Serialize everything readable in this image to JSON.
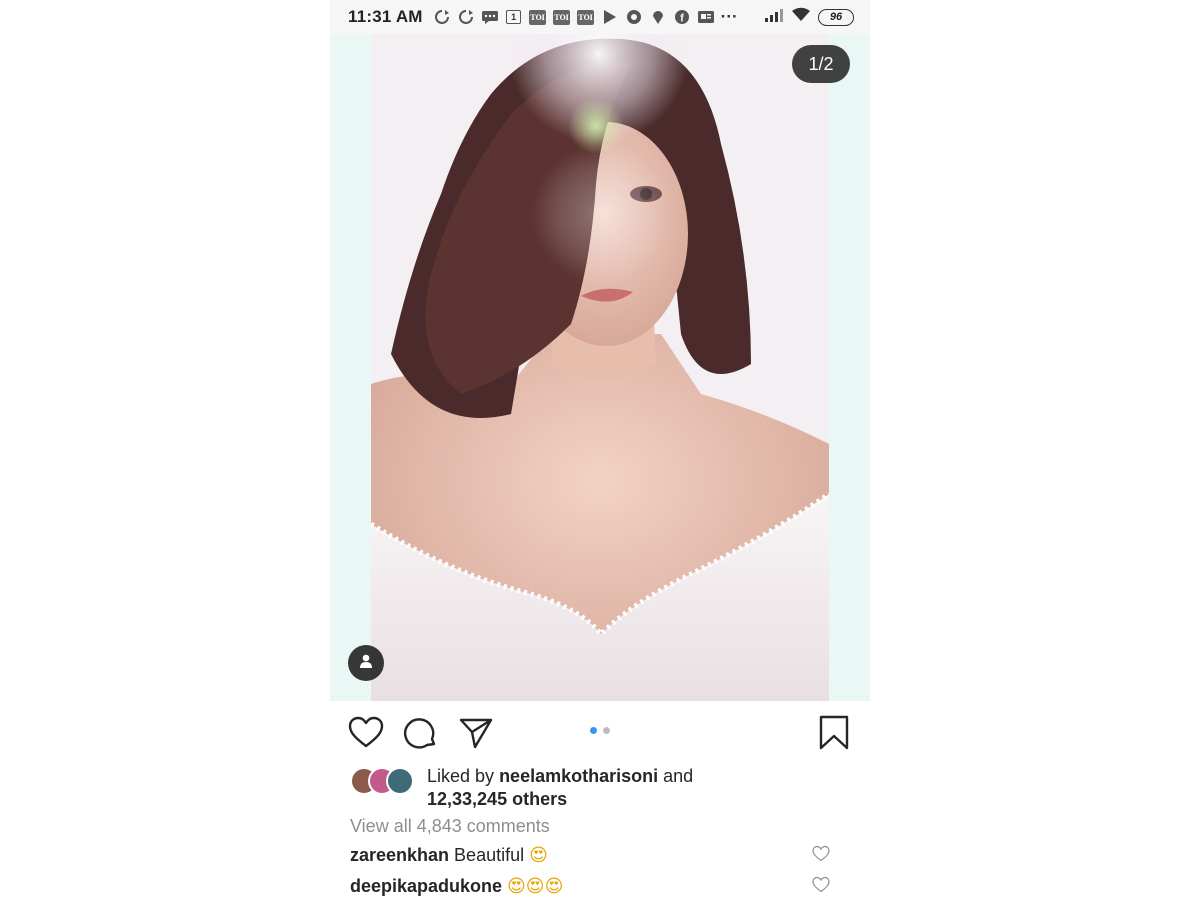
{
  "status_bar": {
    "time": "11:31 AM",
    "notification_icons": [
      {
        "name": "sync-icon",
        "glyph": "↻"
      },
      {
        "name": "sync-icon-2",
        "glyph": "↻"
      },
      {
        "name": "message-icon",
        "glyph": "✉"
      },
      {
        "name": "calendar-icon",
        "glyph": "1"
      },
      {
        "name": "toi-icon",
        "glyph": "TOI"
      },
      {
        "name": "toi-icon-2",
        "glyph": "TOI"
      },
      {
        "name": "toi-icon-3",
        "glyph": "TOI"
      },
      {
        "name": "play-icon",
        "glyph": "▶"
      },
      {
        "name": "shutter-icon",
        "glyph": "✺"
      },
      {
        "name": "location-icon",
        "glyph": "⬤"
      },
      {
        "name": "facebook-icon",
        "glyph": "f"
      },
      {
        "name": "news-icon",
        "glyph": "▣"
      }
    ],
    "more_label": "···",
    "battery": "96"
  },
  "post": {
    "page_counter": "1/2",
    "carousel_active_index": 0,
    "carousel_count": 2,
    "liked_by_prefix": "Liked by",
    "liked_by_user": "neelamkotharisoni",
    "liked_by_and": "and",
    "liked_by_others": "12,33,245 others",
    "view_all_comments": "View all 4,843 comments",
    "comments": [
      {
        "user": "zareenkhan",
        "text": "Beautiful",
        "emoji": "😍"
      },
      {
        "user": "deepikapadukone",
        "text": "",
        "emoji": "😍😍😍"
      }
    ]
  },
  "colors": {
    "accent_blue": "#3897f0",
    "text": "#262626",
    "muted": "#8e8e8e"
  }
}
